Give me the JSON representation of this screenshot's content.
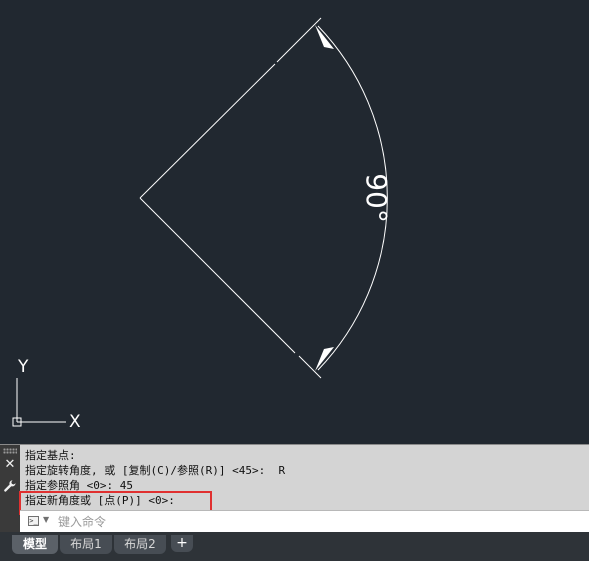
{
  "drawing": {
    "angle_label": "90°",
    "ucs_x_label": "X",
    "ucs_y_label": "Y"
  },
  "command": {
    "history": [
      "指定基点:",
      "指定旋转角度, 或 [复制(C)/参照(R)] <45>:  R",
      "指定参照角 <0>: 45",
      "指定新角度或 [点(P)] <0>:"
    ],
    "prompt_icon": ">_",
    "input_placeholder": "键入命令"
  },
  "tabs": [
    {
      "label": "模型",
      "active": true
    },
    {
      "label": "布局1",
      "active": false
    },
    {
      "label": "布局2",
      "active": false
    }
  ],
  "tab_add_label": "+",
  "colors": {
    "canvas_bg": "#212830",
    "line": "#ffffff",
    "highlight": "#e03030"
  }
}
